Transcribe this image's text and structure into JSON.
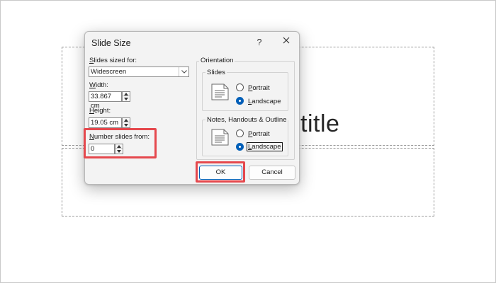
{
  "slide": {
    "title_fragment": "title"
  },
  "dialog": {
    "title": "Slide Size",
    "help_label": "?",
    "slides_sized_for": {
      "label_accel": "S",
      "label_rest": "lides sized for:",
      "value": "Widescreen"
    },
    "width": {
      "label_accel": "W",
      "label_rest": "idth:",
      "value": "33.867 cm"
    },
    "height": {
      "label_accel": "H",
      "label_rest": "eight:",
      "value": "19.05 cm"
    },
    "number_slides_from": {
      "label_accel": "N",
      "label_rest": "umber slides from:",
      "value": "0"
    },
    "orientation": {
      "label": "Orientation",
      "slides_group": {
        "label": "Slides",
        "portrait_accel": "P",
        "portrait_rest": "ortrait",
        "landscape_accel": "L",
        "landscape_rest": "andscape",
        "selected": "landscape"
      },
      "notes_group": {
        "label": "Notes, Handouts & Outline",
        "portrait_accel": "P",
        "portrait_rest": "ortrait",
        "landscape_accel": "L",
        "landscape_rest": "andscape",
        "selected": "landscape"
      }
    },
    "ok_label": "OK",
    "cancel_label": "Cancel"
  },
  "colors": {
    "accent": "#005fb8",
    "highlight": "#e5484d",
    "dialog_bg": "#f3f3f3"
  },
  "icons": {
    "close": "close-icon",
    "dropdown": "chevron-down-icon",
    "spin_up": "spin-up-icon",
    "spin_down": "spin-down-icon",
    "portrait_page": "portrait-page-icon"
  }
}
